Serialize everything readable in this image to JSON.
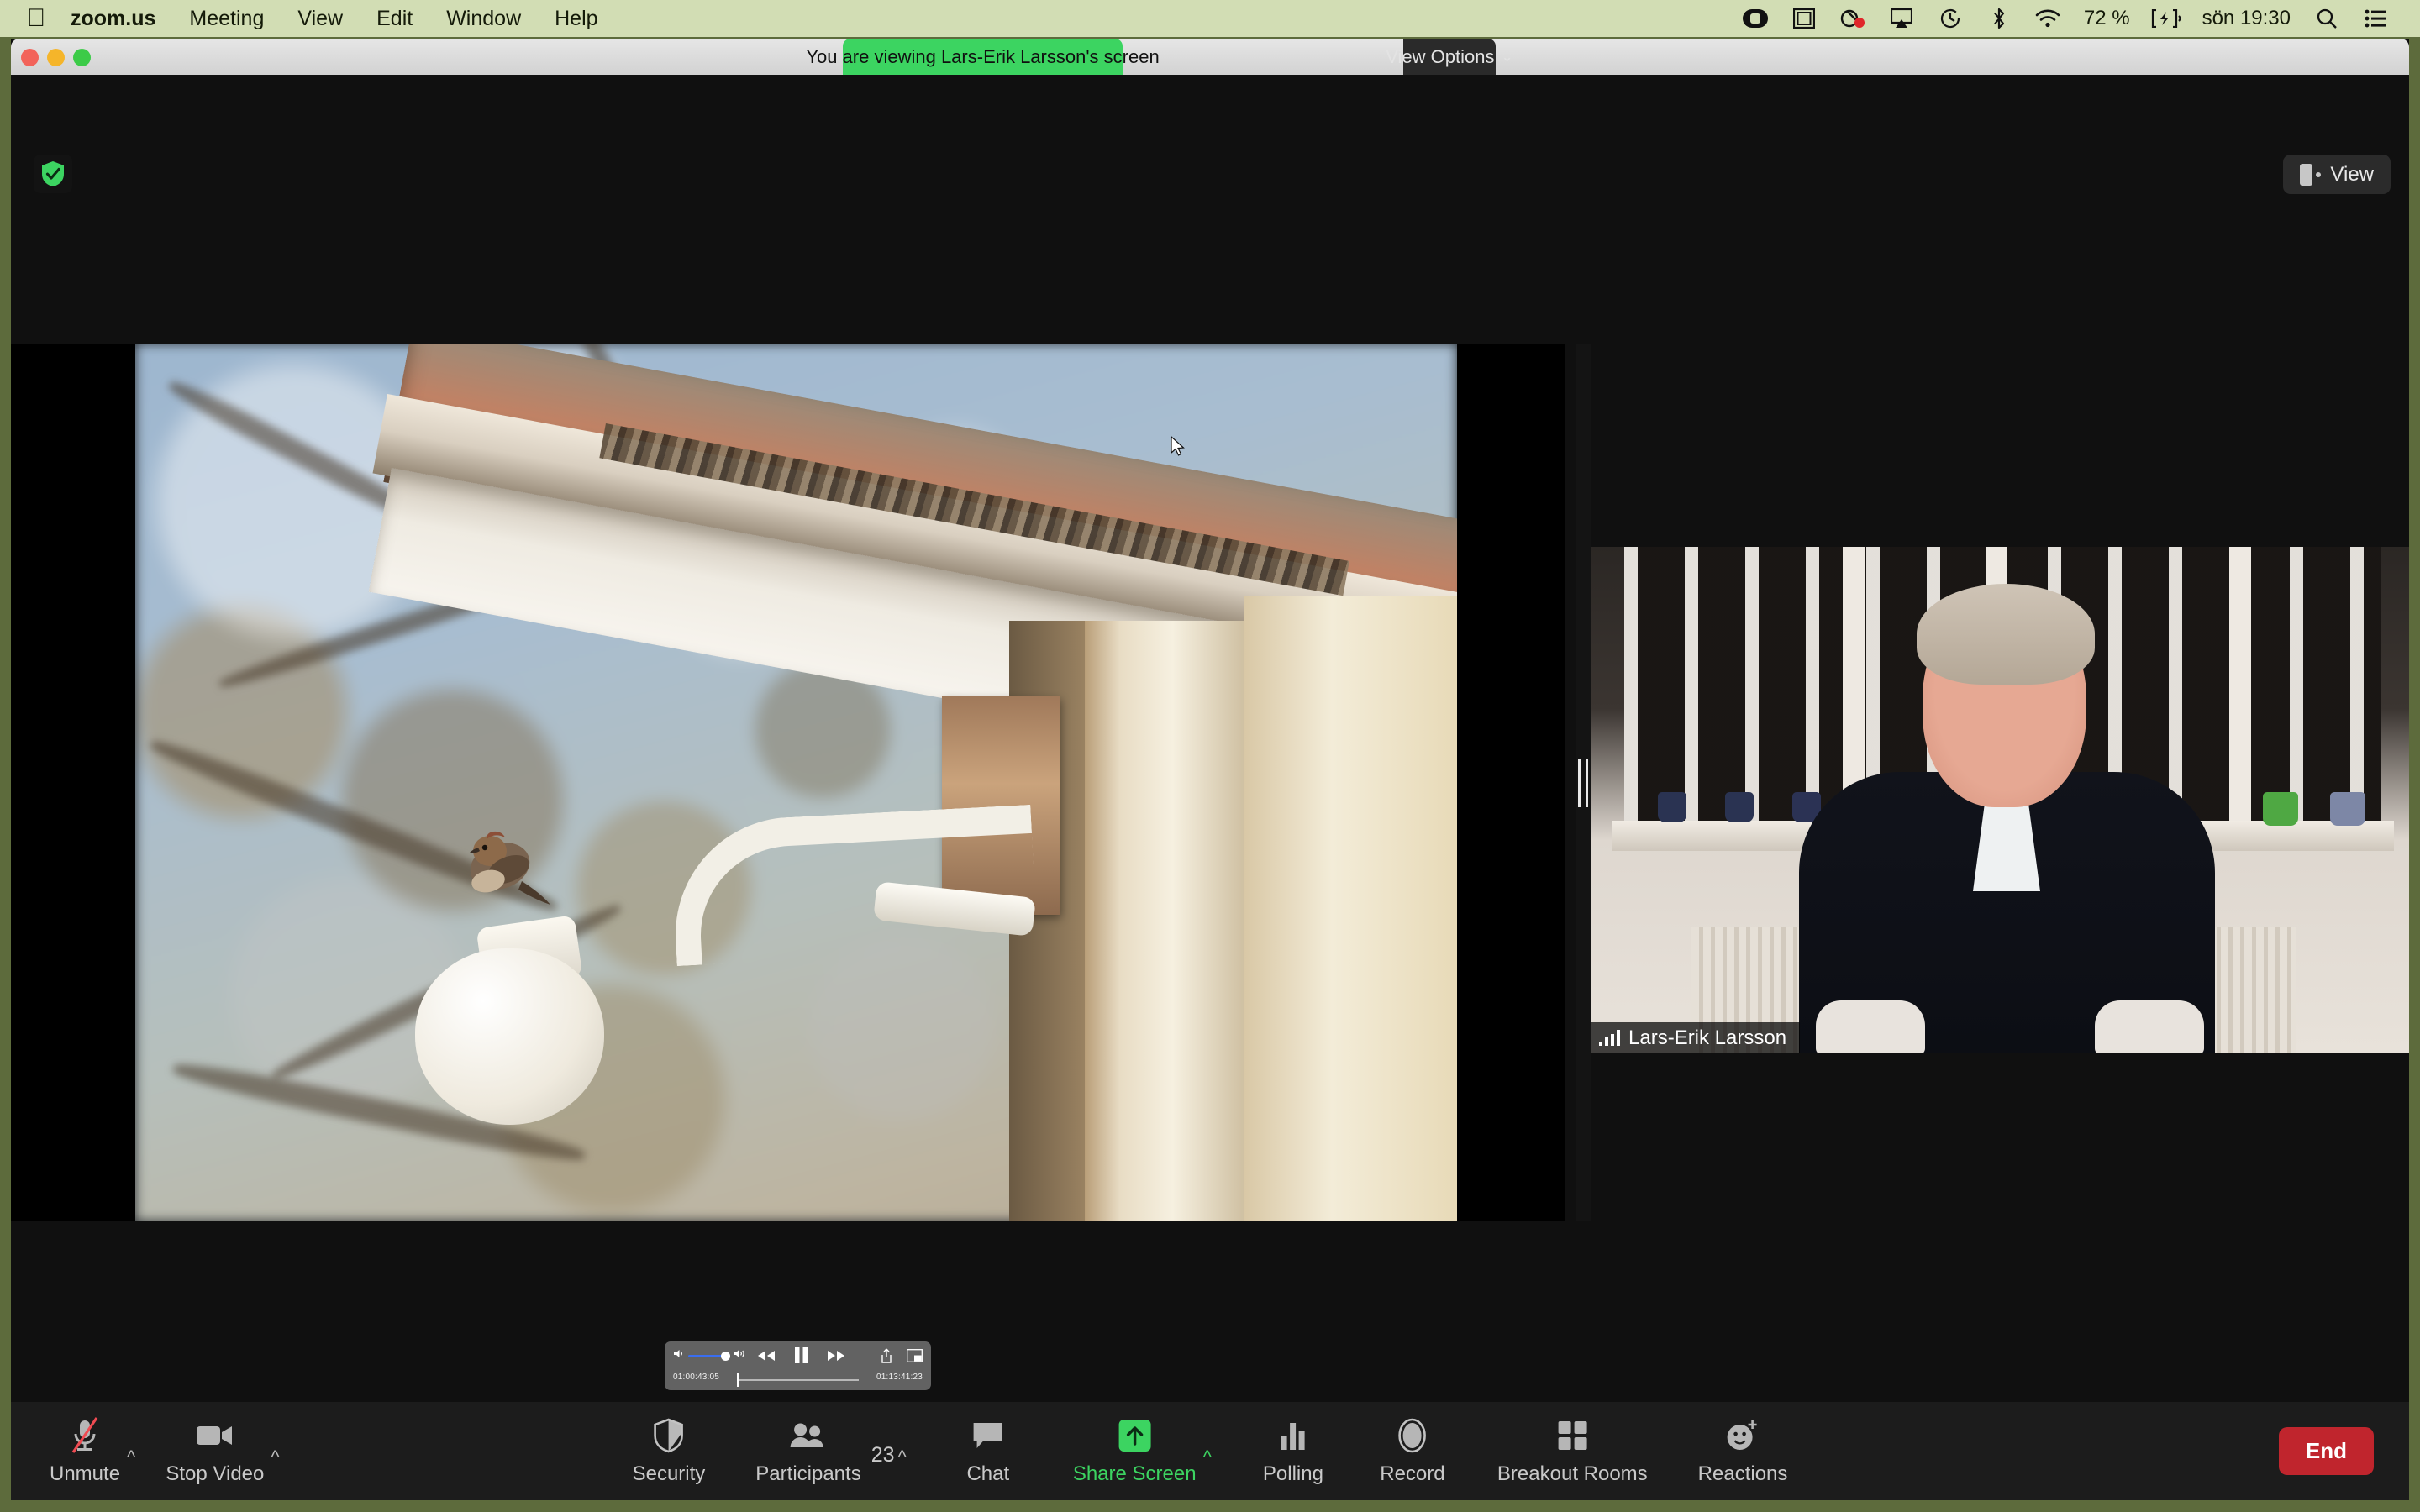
{
  "menubar": {
    "apple_icon": "apple-logo",
    "items": [
      {
        "label": "zoom.us",
        "bold": true
      },
      {
        "label": "Meeting",
        "bold": false
      },
      {
        "label": "View",
        "bold": false
      },
      {
        "label": "Edit",
        "bold": false
      },
      {
        "label": "Window",
        "bold": false
      },
      {
        "label": "Help",
        "bold": false
      }
    ],
    "status": {
      "icons": [
        "screen-recording-icon",
        "screen-mirroring-icon",
        "zoom-menubar-icon",
        "airplay-icon",
        "time-machine-icon",
        "bluetooth-icon",
        "wifi-icon"
      ],
      "battery_percent": "72 %",
      "battery_state": "charging",
      "clock": "sön 19:30",
      "search_icon": "search-icon",
      "control_center_icon": "control-center-icon"
    }
  },
  "window": {
    "share_banner": "You are viewing Lars-Erik Larsson's screen",
    "view_options_label": "View Options",
    "view_options_caret": "⌄",
    "encryption_icon": "shield-check-icon",
    "view_button_label": "View"
  },
  "shared_content": {
    "description": "sparrow perched on outdoor white lamp under roof eaves",
    "player": {
      "current_time": "01:00:43:05",
      "total_time": "01:13:41:23",
      "state": "paused",
      "volume_icons": [
        "volume-low-icon",
        "volume-high-icon"
      ],
      "buttons": [
        "rewind-button",
        "pause-button",
        "fast-forward-button",
        "share-button",
        "picture-in-picture-button"
      ]
    }
  },
  "speaker": {
    "name": "Lars-Erik Larsson",
    "audio_icon": "audio-level-icon"
  },
  "toolbar": {
    "left": [
      {
        "name": "unmute",
        "label": "Unmute",
        "icon": "microphone-muted-icon",
        "caret": "^"
      },
      {
        "name": "stop-video",
        "label": "Stop Video",
        "icon": "video-camera-icon",
        "caret": "^"
      }
    ],
    "center": [
      {
        "name": "security",
        "label": "Security",
        "icon": "shield-icon",
        "caret": ""
      },
      {
        "name": "participants",
        "label": "Participants",
        "icon": "participants-icon",
        "count": "23",
        "caret": "^"
      },
      {
        "name": "chat",
        "label": "Chat",
        "icon": "chat-bubble-icon",
        "caret": ""
      },
      {
        "name": "share-screen",
        "label": "Share Screen",
        "icon": "share-screen-icon",
        "caret": "^",
        "highlight": "#3cd461"
      },
      {
        "name": "polling",
        "label": "Polling",
        "icon": "polling-icon",
        "caret": ""
      },
      {
        "name": "record",
        "label": "Record",
        "icon": "record-icon",
        "caret": ""
      },
      {
        "name": "breakout-rooms",
        "label": "Breakout Rooms",
        "icon": "breakout-rooms-icon",
        "caret": ""
      },
      {
        "name": "reactions",
        "label": "Reactions",
        "icon": "reactions-icon",
        "caret": ""
      }
    ],
    "end_button": "End"
  },
  "colors": {
    "accent_green": "#3cd461",
    "end_red": "#c0252d",
    "toolbar_bg": "#1c1c1c",
    "desktop": "#5d6b3c",
    "menubar_bg": "#d2ddb4"
  }
}
